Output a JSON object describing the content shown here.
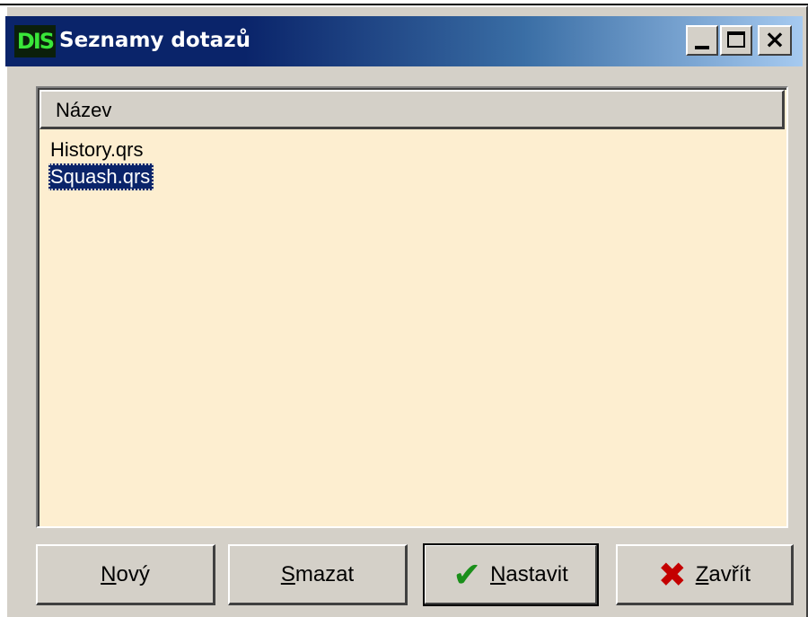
{
  "window": {
    "title": "Seznamy dotazů",
    "icon_text": "DIS",
    "controls": {
      "minimize": "minimize-icon",
      "maximize": "maximize-icon",
      "close": "close-icon"
    }
  },
  "list": {
    "column_header": "Název",
    "items": [
      {
        "label": "History.qrs",
        "selected": false
      },
      {
        "label": "Squash.qrs",
        "selected": true
      }
    ]
  },
  "buttons": {
    "new": {
      "underline": "N",
      "rest": "ový"
    },
    "delete": {
      "underline": "S",
      "rest": "mazat"
    },
    "set": {
      "underline": "N",
      "rest": "astavit",
      "icon": "checkmark-icon"
    },
    "close": {
      "underline": "Z",
      "rest": "avřít",
      "icon": "x-icon"
    }
  },
  "colors": {
    "title_bar_start": "#0a246a",
    "title_bar_end": "#a6caf0",
    "list_background": "#fdeed0",
    "selection": "#0a246a",
    "check_green": "#1a8f1a",
    "x_red": "#c40000"
  }
}
